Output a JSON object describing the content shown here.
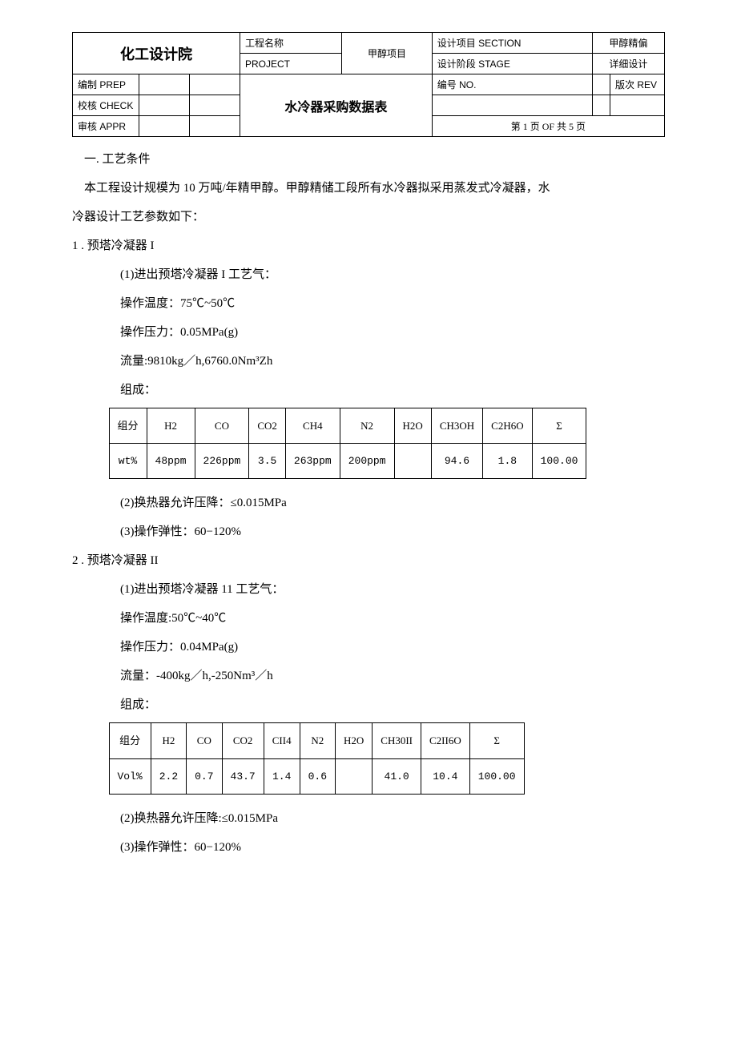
{
  "header": {
    "institute": "化工设计院",
    "project_label": "工程名称",
    "project_label_en": "PROJECT",
    "project_name": "甲醇项目",
    "section_label": "设计项目 SECTION",
    "section_value": "甲醇精偏",
    "stage_label": "设计阶段 STAGE",
    "stage_value": "详细设计",
    "prep_label": "编制 PREP",
    "check_label": "校核 CHECK",
    "appr_label": "审核 APPR",
    "doc_title": "水冷器采购数据表",
    "no_label": "编号 NO.",
    "rev_label": "版次 REV",
    "page_info": "第 1 页 OF 共 5 页"
  },
  "section1": {
    "title": "一. 工艺条件",
    "intro1": "本工程设计规模为 10 万吨/年精甲醇。甲醇精储工段所有水冷器拟采用蒸发式冷凝器，水",
    "intro2": "冷器设计工艺参数如下：",
    "item1_title": "1  . 预塔冷凝器 I",
    "item1_1": "(1)进出预塔冷凝器 I 工艺气：",
    "item1_temp": "操作温度：75℃~50℃",
    "item1_press": "操作压力：0.05MPa(g)",
    "item1_flow": "流量:9810kg／h,6760.0Nm³Zh",
    "item1_comp": "组成：",
    "item1_2": "(2)换热器允许压降：≤0.015MPa",
    "item1_3": "(3)操作弹性：60−120%",
    "item2_title": "2  . 预塔冷凝器 II",
    "item2_1": "(1)进出预塔冷凝器 11 工艺气：",
    "item2_temp": "操作温度:50℃~40℃",
    "item2_press": "操作压力：0.04MPa(g)",
    "item2_flow": "流量：-400kg／h,-250Nm³／h",
    "item2_comp": "组成：",
    "item2_2": "(2)换热器允许压降:≤0.015MPa",
    "item2_3": "(3)操作弹性：60−120%"
  },
  "table1": {
    "headers": [
      "组分",
      "H2",
      "CO",
      "CO2",
      "CH4",
      "N2",
      "H2O",
      "CH3OH",
      "C2H6O",
      "Σ"
    ],
    "row_label": "wt%",
    "values": [
      "48ppm",
      "226ppm",
      "3.5",
      "263ppm",
      "200ppm",
      "",
      "94.6",
      "1.8",
      "100.00"
    ]
  },
  "table2": {
    "headers": [
      "组分",
      "H2",
      "CO",
      "CO2",
      "CII4",
      "N2",
      "H2O",
      "CH30II",
      "C2II6O",
      "Σ"
    ],
    "row_label": "Vol%",
    "values": [
      "2.2",
      "0.7",
      "43.7",
      "1.4",
      "0.6",
      "",
      "41.0",
      "10.4",
      "100.00"
    ]
  }
}
